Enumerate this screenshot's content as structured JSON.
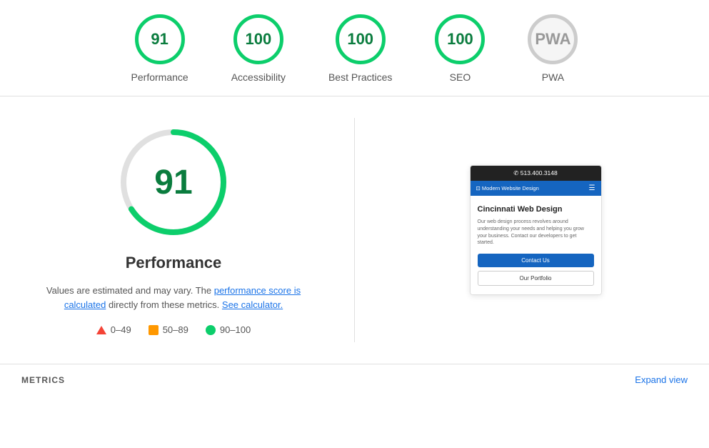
{
  "scores_bar": {
    "items": [
      {
        "id": "performance",
        "value": "91",
        "label": "Performance",
        "type": "green"
      },
      {
        "id": "accessibility",
        "value": "100",
        "label": "Accessibility",
        "type": "green"
      },
      {
        "id": "best_practices",
        "value": "100",
        "label": "Best Practices",
        "type": "green"
      },
      {
        "id": "seo",
        "value": "100",
        "label": "SEO",
        "type": "green"
      },
      {
        "id": "pwa",
        "value": "PWA",
        "label": "PWA",
        "type": "gray"
      }
    ]
  },
  "main": {
    "big_score": "91",
    "title": "Performance",
    "description_text": "Values are estimated and may vary. The ",
    "description_link1": "performance score is calculated",
    "description_mid": " directly from these metrics. ",
    "description_link2": "See calculator.",
    "legend": [
      {
        "type": "triangle",
        "range": "0–49"
      },
      {
        "type": "square",
        "range": "50–89"
      },
      {
        "type": "dot",
        "range": "90–100"
      }
    ]
  },
  "preview": {
    "topbar_text": "✆ 513.400.3148",
    "nav_logo": "⊡ Modern Website Design",
    "heading": "Cincinnati Web Design",
    "body_text": "Our web design process revolves around understanding your needs and helping you grow your business. Contact our developers to get started.",
    "btn_primary": "Contact Us",
    "btn_secondary": "Our Portfolio"
  },
  "metrics_section": {
    "label": "METRICS",
    "expand_label": "Expand view"
  }
}
